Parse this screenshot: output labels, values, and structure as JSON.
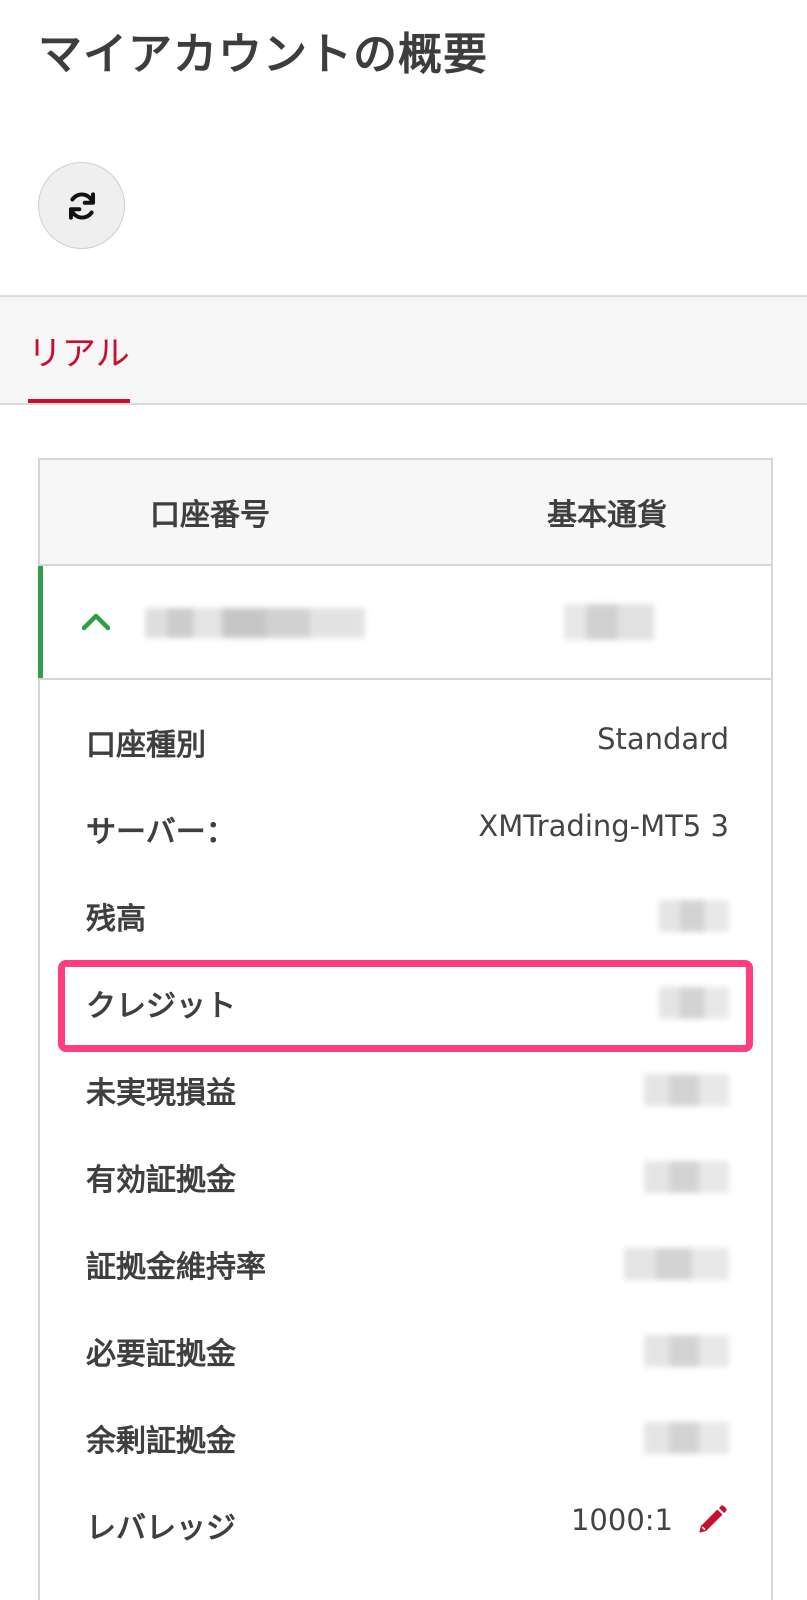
{
  "page": {
    "title": "マイアカウントの概要"
  },
  "toolbar": {
    "refresh_icon": "refresh-icon"
  },
  "tabs": [
    {
      "label": "リアル",
      "active": true
    }
  ],
  "table": {
    "headers": {
      "account_number": "口座番号",
      "base_currency": "基本通貨"
    },
    "account_row": {
      "expanded": true,
      "chevron_icon": "chevron-up-icon"
    }
  },
  "details": {
    "account_type": {
      "label": "口座種別",
      "value": "Standard"
    },
    "server": {
      "label": "サーバー：",
      "value": "XMTrading-MT5 3"
    },
    "balance": {
      "label": "残高"
    },
    "credit": {
      "label": "クレジット"
    },
    "unrealized_pl": {
      "label": "未実現損益"
    },
    "equity": {
      "label": "有効証拠金"
    },
    "margin_level": {
      "label": "証拠金維持率"
    },
    "required_margin": {
      "label": "必要証拠金"
    },
    "free_margin": {
      "label": "余剰証拠金"
    },
    "leverage": {
      "label": "レバレッジ",
      "value": "1000:1",
      "edit_icon": "pencil-icon"
    }
  },
  "colors": {
    "accent": "#c8102e",
    "active_row": "#2e9e49",
    "highlight": "#ff3d7f"
  }
}
